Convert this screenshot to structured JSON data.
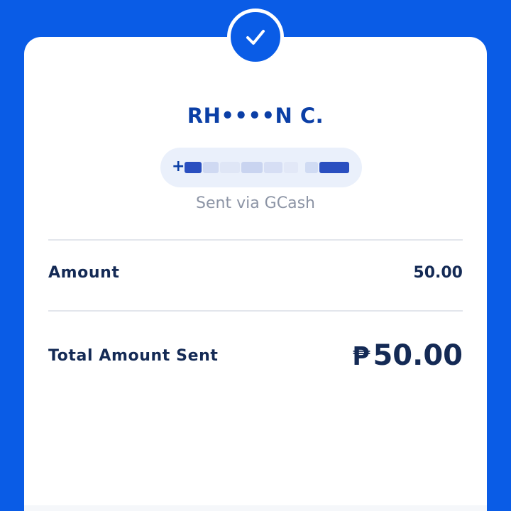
{
  "colors": {
    "brand_blue": "#0a5ce6",
    "name_blue": "#0b3fa6",
    "text_dark": "#142a55",
    "text_muted": "#8c94a5",
    "pill_bg": "#eaf0fb",
    "divider": "#e3e6ec"
  },
  "status": {
    "icon": "check-icon"
  },
  "recipient": {
    "name": "RH••••N C.",
    "phone_prefix": "+",
    "phone_redacted": true,
    "sent_via": "Sent via GCash"
  },
  "details": {
    "amount_label": "Amount",
    "amount_value": "50.00",
    "total_label": "Total Amount Sent",
    "currency_symbol": "₱",
    "total_value": "50.00"
  }
}
